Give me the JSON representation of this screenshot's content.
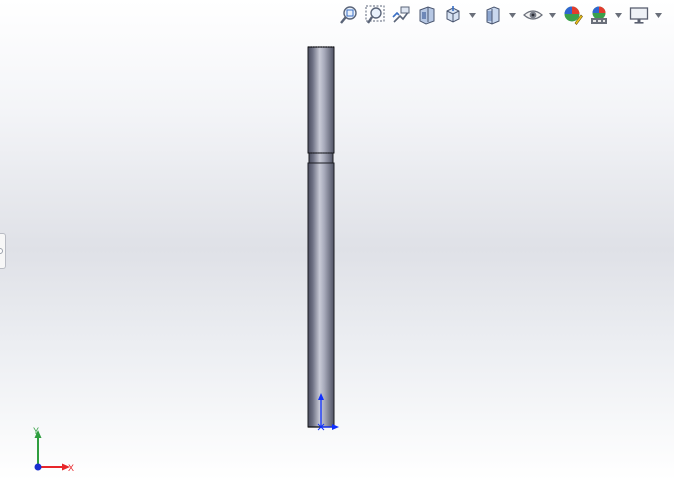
{
  "toolbar": {
    "buttons": [
      {
        "name": "zoom-to-fit",
        "icon": "zoom-to-fit-icon"
      },
      {
        "name": "zoom-to-area",
        "icon": "zoom-to-area-icon"
      },
      {
        "name": "previous-view",
        "icon": "previous-view-icon"
      },
      {
        "name": "section-view",
        "icon": "section-view-icon"
      },
      {
        "name": "view-orientation",
        "icon": "view-orientation-icon",
        "dropdown": true
      },
      {
        "name": "display-style",
        "icon": "display-style-icon",
        "dropdown": true
      },
      {
        "name": "hide-show-items",
        "icon": "eye-icon",
        "dropdown": true
      },
      {
        "name": "edit-appearance",
        "icon": "edit-appearance-icon"
      },
      {
        "name": "apply-scene",
        "icon": "apply-scene-icon",
        "dropdown": true
      },
      {
        "name": "view-settings",
        "icon": "monitor-icon",
        "dropdown": true
      }
    ]
  },
  "triad": {
    "x_label": "X",
    "y_label": "Y",
    "colors": {
      "x": "#e8262a",
      "y": "#2f9e3f",
      "z": "#1a2fd0"
    }
  },
  "model": {
    "fill_dark": "#4a4d5f",
    "fill_light": "#c8cad6"
  },
  "origin_marker_color": "#1030ff"
}
